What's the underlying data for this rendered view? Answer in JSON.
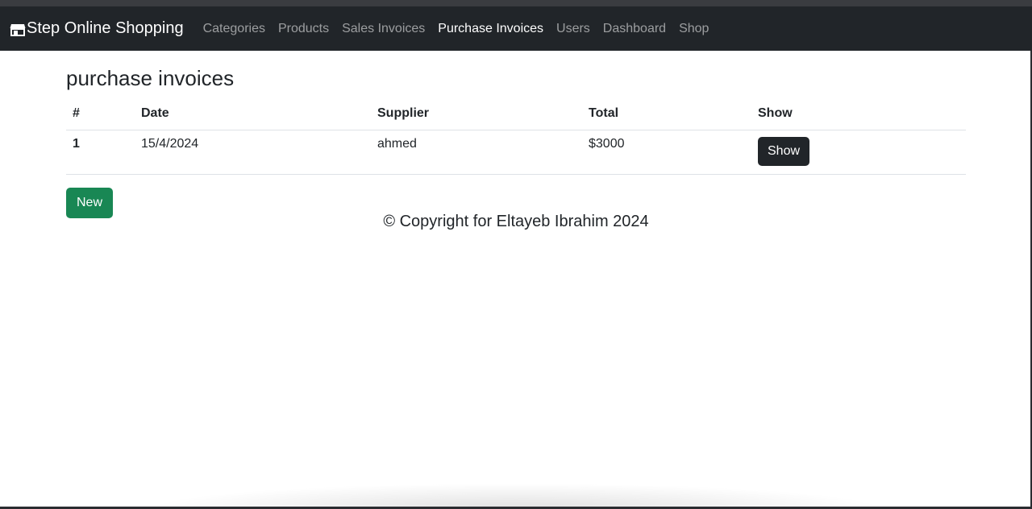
{
  "navbar": {
    "brand": "Step Online Shopping",
    "brand_icon": "shop-icon",
    "links": [
      {
        "label": "Categories",
        "active": false
      },
      {
        "label": "Products",
        "active": false
      },
      {
        "label": "Sales Invoices",
        "active": false
      },
      {
        "label": "Purchase Invoices",
        "active": true
      },
      {
        "label": "Users",
        "active": false
      },
      {
        "label": "Dashboard",
        "active": false
      },
      {
        "label": "Shop",
        "active": false
      }
    ]
  },
  "main": {
    "title": "purchase invoices",
    "table": {
      "headers": [
        "#",
        "Date",
        "Supplier",
        "Total",
        "Show"
      ],
      "rows": [
        {
          "index": "1",
          "date": "15/4/2024",
          "supplier": "ahmed",
          "total": "$3000",
          "show_label": "Show"
        }
      ]
    },
    "new_button": "New"
  },
  "footer": {
    "text": "© Copyright for Eltayeb Ibrahim 2024"
  },
  "colors": {
    "navbar_bg": "#212529",
    "new_button_bg": "#198754",
    "show_button_bg": "#212529"
  }
}
